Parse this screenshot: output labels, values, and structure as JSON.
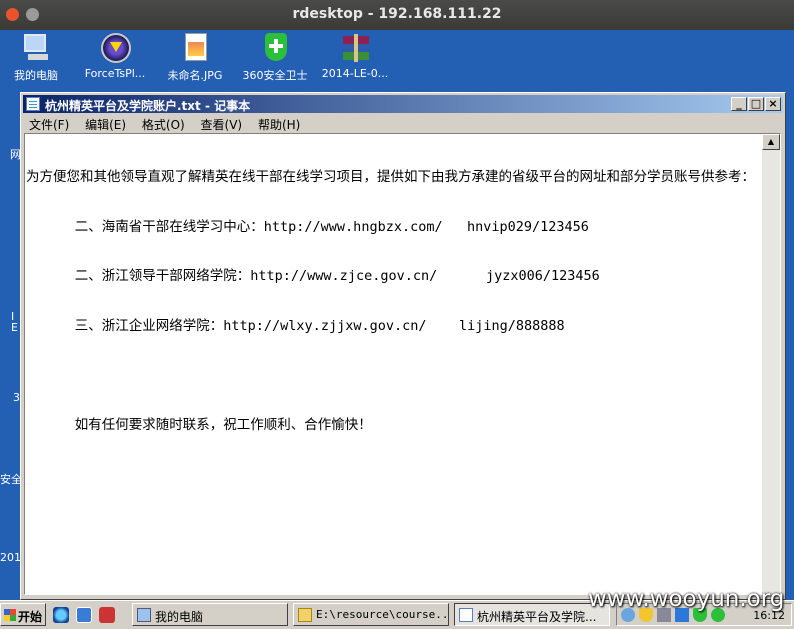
{
  "outer_window": {
    "title": "rdesktop - 192.168.111.22"
  },
  "desktop": {
    "icons": [
      {
        "label": "我的电脑",
        "icon": "computer-icon"
      },
      {
        "label": "ForceTsPl...",
        "icon": "disc-player-icon"
      },
      {
        "label": "未命名.JPG",
        "icon": "image-file-icon"
      },
      {
        "label": "360安全卫士",
        "icon": "shield-plus-icon"
      },
      {
        "label": "2014-LE-0...",
        "icon": "rar-archive-icon"
      }
    ],
    "edge_labels": [
      "网",
      "I",
      "E",
      "3",
      "安全",
      "201"
    ]
  },
  "notepad": {
    "title": "杭州精英平台及学院账户.txt - 记事本",
    "controls": {
      "minimize": "_",
      "maximize": "□",
      "close": "×"
    },
    "menu": [
      "文件(F)",
      "编辑(E)",
      "格式(O)",
      "查看(V)",
      "帮助(H)"
    ],
    "lines": [
      "为方便您和其他领导直观了解精英在线干部在线学习项目，提供如下由我方承建的省级平台的网址和部分学员账号供参考：",
      "      二、海南省干部在线学习中心：http://www.hngbzx.com/   hnvip029/123456",
      "      二、浙江领导干部网络学院：http://www.zjce.gov.cn/      jyzx006/123456",
      "      三、浙江企业网络学院：http://wlxy.zjjxw.gov.cn/    lijing/888888",
      "",
      "      如有任何要求随时联系，祝工作顺利、合作愉快！"
    ]
  },
  "taskbar": {
    "start_label": "开始",
    "tasks": [
      {
        "label": "我的电脑",
        "active": false
      },
      {
        "label": "E:\\resource\\course...",
        "active": false
      },
      {
        "label": "杭州精英平台及学院...",
        "active": true
      }
    ],
    "clock": "16:12"
  },
  "watermark": "www.wooyun.org"
}
